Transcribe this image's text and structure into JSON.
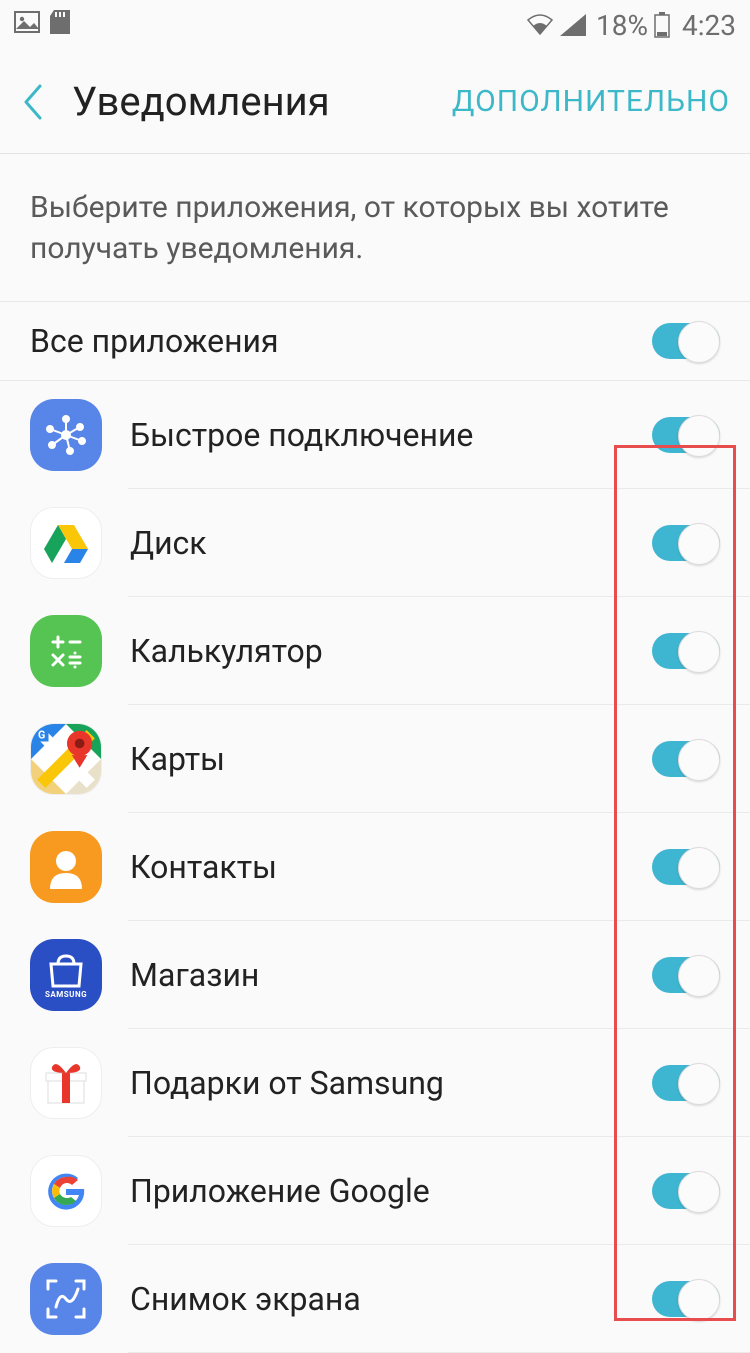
{
  "status": {
    "battery_pct": "18%",
    "time": "4:23"
  },
  "header": {
    "title": "Уведомления",
    "action": "ДОПОЛНИТЕЛЬНО"
  },
  "description": "Выберите приложения, от которых вы хотите получать уведомления.",
  "all_apps_label": "Все приложения",
  "apps": [
    {
      "label": "Быстрое подключение",
      "enabled": true
    },
    {
      "label": "Диск",
      "enabled": true
    },
    {
      "label": "Калькулятор",
      "enabled": true
    },
    {
      "label": "Карты",
      "enabled": true
    },
    {
      "label": "Контакты",
      "enabled": true
    },
    {
      "label": "Магазин",
      "enabled": true
    },
    {
      "label": "Подарки от Samsung",
      "enabled": true
    },
    {
      "label": "Приложение Google",
      "enabled": true
    },
    {
      "label": "Снимок экрана",
      "enabled": true
    }
  ]
}
